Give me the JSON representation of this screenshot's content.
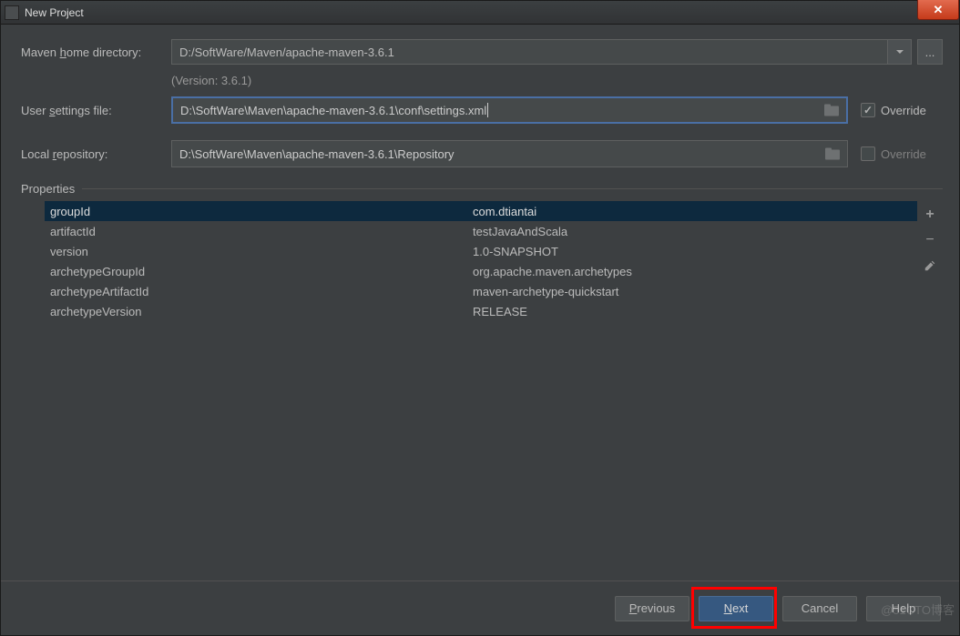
{
  "window": {
    "title": "New Project",
    "close_label": "✕"
  },
  "form": {
    "maven_home_label_pre": "Maven ",
    "maven_home_label_u": "h",
    "maven_home_label_post": "ome directory:",
    "maven_home_value": "D:/SoftWare/Maven/apache-maven-3.6.1",
    "ellipsis": "...",
    "version_hint": "(Version: 3.6.1)",
    "user_settings_label_pre": "User ",
    "user_settings_label_u": "s",
    "user_settings_label_post": "ettings file:",
    "user_settings_value": "D:\\SoftWare\\Maven\\apache-maven-3.6.1\\conf\\settings.xml",
    "local_repo_label_pre": "Local ",
    "local_repo_label_u": "r",
    "local_repo_label_post": "epository:",
    "local_repo_value": "D:\\SoftWare\\Maven\\apache-maven-3.6.1\\Repository",
    "override_label": "Override",
    "override_settings_checked": true,
    "override_repo_checked": false
  },
  "properties": {
    "section_label": "Properties",
    "rows": [
      {
        "key": "groupId",
        "value": "com.dtiantai",
        "selected": true
      },
      {
        "key": "artifactId",
        "value": "testJavaAndScala",
        "selected": false
      },
      {
        "key": "version",
        "value": "1.0-SNAPSHOT",
        "selected": false
      },
      {
        "key": "archetypeGroupId",
        "value": "org.apache.maven.archetypes",
        "selected": false
      },
      {
        "key": "archetypeArtifactId",
        "value": "maven-archetype-quickstart",
        "selected": false
      },
      {
        "key": "archetypeVersion",
        "value": "RELEASE",
        "selected": false
      }
    ],
    "tool_add": "add",
    "tool_remove": "remove",
    "tool_edit": "edit"
  },
  "footer": {
    "previous_u": "P",
    "previous_rest": "revious",
    "next_u": "N",
    "next_rest": "ext",
    "cancel": "Cancel",
    "help": "Help"
  },
  "watermark": "@51CTO博客"
}
